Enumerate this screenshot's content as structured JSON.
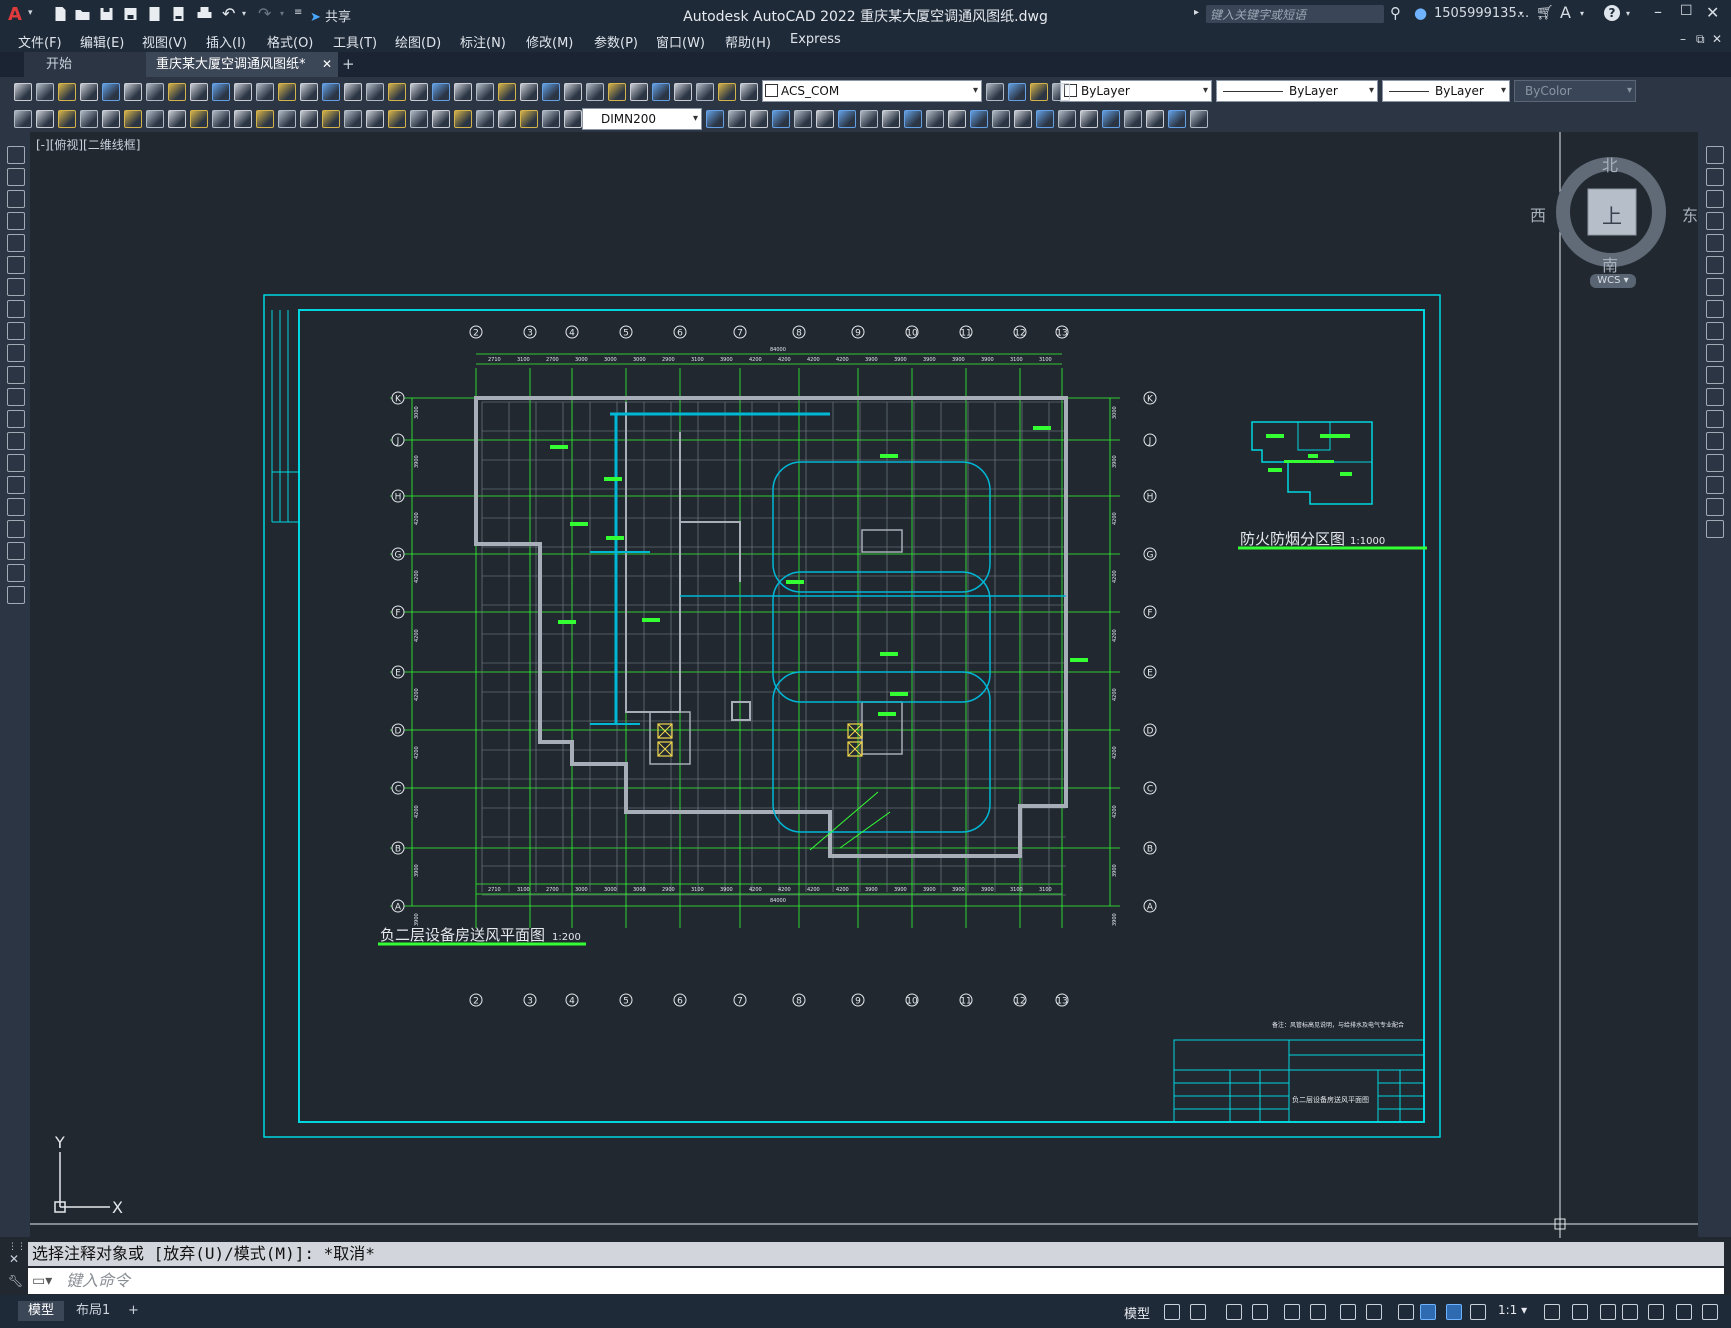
{
  "app": {
    "title": "Autodesk AutoCAD 2022    重庆某大厦空调通风图纸.dwg",
    "share": "共享",
    "search_placeholder": "键入关键字或短语",
    "user": "1505999135...",
    "help": "?"
  },
  "menu": [
    "文件(F)",
    "编辑(E)",
    "视图(V)",
    "插入(I)",
    "格式(O)",
    "工具(T)",
    "绘图(D)",
    "标注(N)",
    "修改(M)",
    "参数(P)",
    "窗口(W)",
    "帮助(H)",
    "Express"
  ],
  "tabs": [
    {
      "label": "开始",
      "active": false
    },
    {
      "label": "重庆某大厦空调通风图纸*",
      "active": true
    }
  ],
  "toolbar": {
    "layer": "ACS_COM",
    "color": "ByLayer",
    "linetype": "ByLayer",
    "lineweight": "ByLayer",
    "plotstyle": "ByColor",
    "dimstyle": "DIMN200"
  },
  "viewport_label": "[-][俯视][二维线框]",
  "viewcube": {
    "north": "北",
    "south": "南",
    "east": "东",
    "west": "西",
    "top": "上",
    "wcs": "WCS"
  },
  "drawing": {
    "main_title": "负二层设备房送风平面图",
    "main_scale": "1:200",
    "inset_title": "防火防烟分区图",
    "inset_scale": "1:1000",
    "column_labels": [
      "2",
      "3",
      "4",
      "5",
      "6",
      "7",
      "8",
      "9",
      "10",
      "11",
      "12",
      "13"
    ],
    "row_labels": [
      "K",
      "J",
      "H",
      "G",
      "F",
      "E",
      "D",
      "C",
      "B",
      "A"
    ],
    "top_dims": [
      "2710",
      "3100",
      "2700",
      "3000",
      "3000",
      "3000",
      "2900",
      "3100",
      "3900",
      "4200",
      "4200",
      "4200",
      "4200",
      "3900",
      "3900",
      "3900",
      "3900",
      "3900",
      "3100",
      "3100"
    ],
    "total_width": "84000",
    "side_dims": [
      "3000",
      "3900",
      "4200",
      "4200",
      "4200",
      "4200",
      "4200",
      "4200",
      "3900",
      "3900"
    ],
    "notes": "备注：风管标高见说明，与给排水及电气专业配合",
    "title_block": "负二层设备房送风平面图"
  },
  "command": {
    "history": "选择注释对象或 [放弃(U)/模式(M)]: *取消*",
    "placeholder": "键入命令"
  },
  "status": {
    "model_tab": "模型",
    "layout_tab": "布局1",
    "model_button": "模型",
    "scale": "1:1"
  },
  "axis": {
    "x": "X",
    "y": "Y"
  }
}
